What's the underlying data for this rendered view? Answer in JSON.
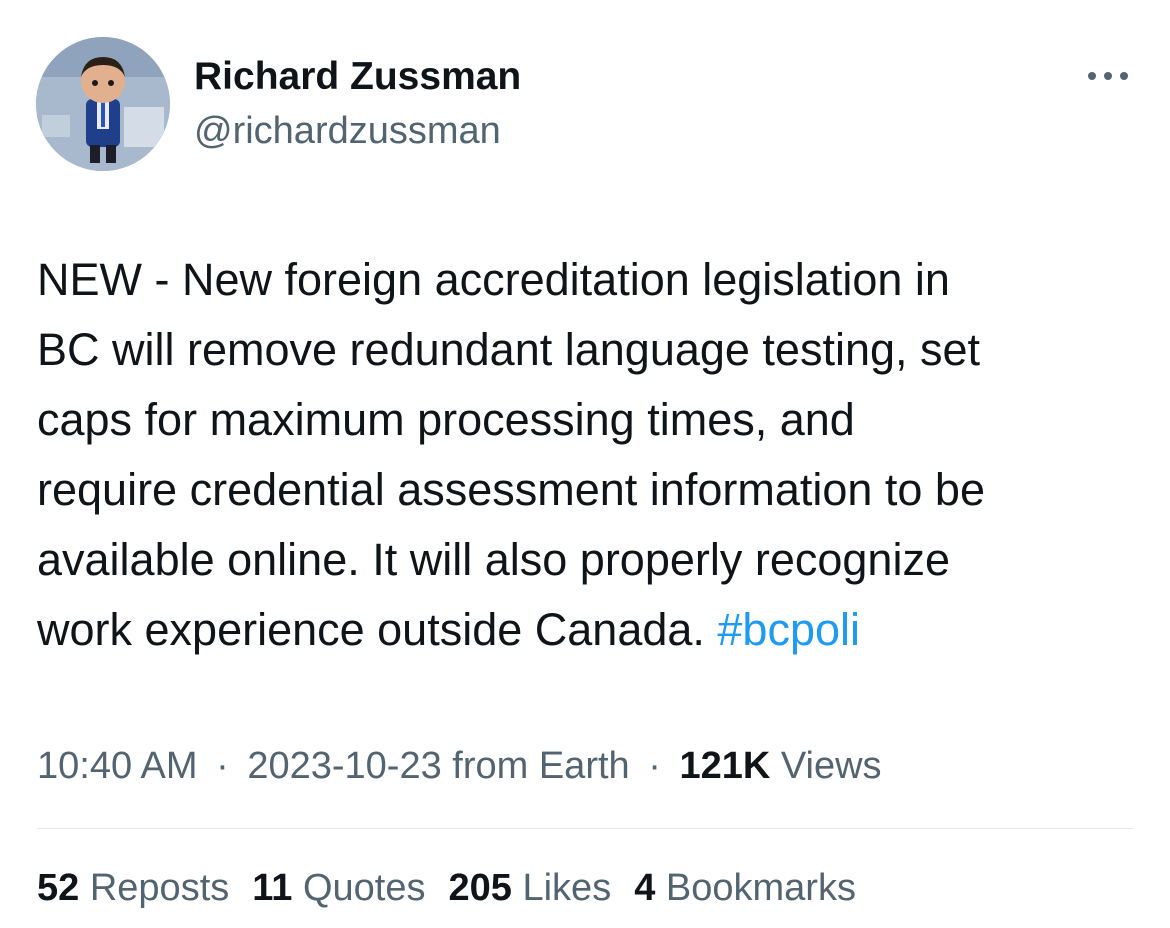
{
  "author": {
    "name": "Richard Zussman",
    "handle": "@richardzussman"
  },
  "tweet": {
    "lines": [
      "NEW - New foreign accreditation legislation in",
      "BC will remove redundant language testing, set",
      "caps for maximum processing times, and",
      "require credential assessment information to be",
      "available online. It will also properly recognize",
      "work experience outside Canada. "
    ],
    "hashtag": "#bcpoli"
  },
  "meta": {
    "time": "10:40 AM",
    "sep1": "·",
    "date_source": "2023-10-23 from Earth",
    "sep2": "·",
    "views_count": "121K",
    "views_label": "Views"
  },
  "stats": {
    "reposts_count": "52",
    "reposts_label": "Reposts",
    "quotes_count": "11",
    "quotes_label": "Quotes",
    "likes_count": "205",
    "likes_label": "Likes",
    "bookmarks_count": "4",
    "bookmarks_label": "Bookmarks"
  },
  "colors": {
    "link": "#1d9bf0",
    "secondary_text": "#536471",
    "primary_text": "#0f1419",
    "divider": "#e7e9ec"
  },
  "icons": {
    "more": "more-horizontal-icon"
  }
}
